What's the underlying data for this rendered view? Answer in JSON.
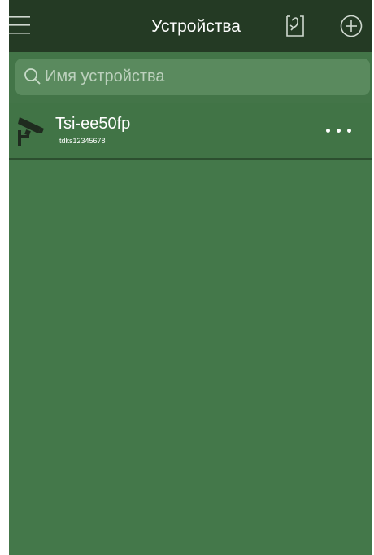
{
  "header": {
    "title": "Устройства",
    "menu_icon": "hamburger-menu-icon",
    "import_icon": "import-icon",
    "add_icon": "add-circle-icon"
  },
  "search": {
    "placeholder": "Имя устройства",
    "value": ""
  },
  "devices": [
    {
      "name": "Tsi-ee50fp",
      "id": "tdks12345678",
      "icon": "camera-icon",
      "more_icon": "more-dots-icon"
    }
  ],
  "colors": {
    "header_bg": "#243a24",
    "body_bg": "#44784a",
    "search_bg": "#5a8a5e",
    "text": "#ffffff"
  }
}
